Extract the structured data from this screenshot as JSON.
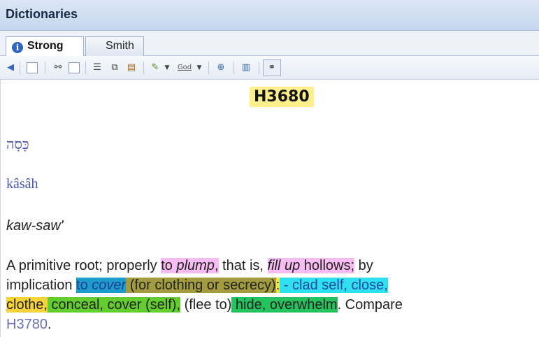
{
  "panel": {
    "title": "Dictionaries"
  },
  "tabs": [
    {
      "label": "Strong",
      "active": true
    },
    {
      "label": "Smith",
      "active": false
    }
  ],
  "toolbar": {
    "icons": [
      "back-arrow-icon",
      "print-icon",
      "find-icon",
      "search-icon",
      "document-icon",
      "copy-icon",
      "paste-icon",
      "highlighter-icon",
      "dropdown-arrow-icon",
      "god-icon",
      "dropdown-arrow-icon",
      "zoom-icon",
      "book-icon",
      "link-icon"
    ],
    "god_label": "God"
  },
  "entry": {
    "id": "H3680",
    "hebrew": "כָּסָה",
    "transliteration": "kâsâh",
    "pronunciation": "kaw-saw'",
    "definition": {
      "line1_a": "A primitive root; properly ",
      "line1_b_pre": "to ",
      "line1_b_em": "plump",
      "line1_b_post": ",",
      "line1_c": " that is, ",
      "line1_d_em": "fill up",
      "line1_d_post": " hollows;",
      "line1_e": " by",
      "line2_a": "implication ",
      "line2_b_pre": "to ",
      "line2_b_em": "cover",
      "line2_c": " (for clothing or secrecy)",
      "line2_d": ":",
      "line2_e": " - clad self, close,",
      "line3_a": "clothe,",
      "line3_b": " conceal, cover (self),",
      "line3_c": " (flee to)",
      "line3_d": " hide, overwhelm",
      "line3_e": ". Compare",
      "line4_link": "H3780",
      "line4_end": "."
    }
  },
  "colors": {
    "highlight_pink": "#f7bdf2",
    "highlight_blue": "#1d9ccf",
    "highlight_olive": "#a39c3e",
    "highlight_yellow": "#f4e83b",
    "highlight_cyan": "#2fe0f0",
    "highlight_green": "#63cc2e",
    "highlight_darkgreen": "#25c35e",
    "entry_id_bg": "#ffef8a"
  }
}
